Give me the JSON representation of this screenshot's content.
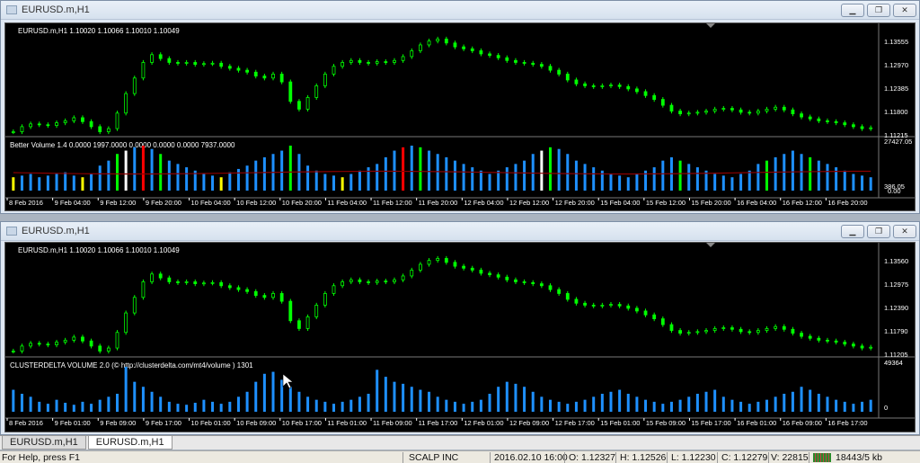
{
  "windows": [
    {
      "title": "EURUSD.m,H1",
      "price_header": "EURUSD.m,H1  1.10020 1.10066 1.10010 1.10049",
      "price_ticks": [
        "1.13555",
        "1.12970",
        "1.12385",
        "1.11800",
        "1.11215"
      ],
      "indicator_header": "Better Volume 1.4 0.0000 1997.0000 0.0000 0.0000 0.0000 7937.0000",
      "indicator_ticks": [
        "27427.05",
        "386.05"
      ],
      "indicator_zero_label": "0.00",
      "date_labels": [
        "8 Feb 2016",
        "9 Feb 04:00",
        "9 Feb 12:00",
        "9 Feb 20:00",
        "10 Feb 04:00",
        "10 Feb 12:00",
        "10 Feb 20:00",
        "11 Feb 04:00",
        "11 Feb 12:00",
        "11 Feb 20:00",
        "12 Feb 04:00",
        "12 Feb 12:00",
        "12 Feb 20:00",
        "15 Feb 04:00",
        "15 Feb 12:00",
        "15 Feb 20:00",
        "16 Feb 04:00",
        "16 Feb 12:00",
        "16 Feb 20:00"
      ]
    },
    {
      "title": "EURUSD.m,H1",
      "price_header": "EURUSD.m,H1  1.10020 1.10066 1.10010 1.10049",
      "price_ticks": [
        "1.13560",
        "1.12975",
        "1.12390",
        "1.11790",
        "1.11205"
      ],
      "indicator_header": "CLUSTERDELTA VOLUME 2.0 (© http://clusterdelta.com/mt4/volume ) 1301",
      "indicator_ticks": [
        "49364",
        "0"
      ],
      "date_labels": [
        "8 Feb 2016",
        "9 Feb 01:00",
        "9 Feb 09:00",
        "9 Feb 17:00",
        "10 Feb 01:00",
        "10 Feb 09:00",
        "10 Feb 17:00",
        "11 Feb 01:00",
        "11 Feb 09:00",
        "11 Feb 17:00",
        "12 Feb 01:00",
        "12 Feb 09:00",
        "12 Feb 17:00",
        "15 Feb 01:00",
        "15 Feb 09:00",
        "15 Feb 17:00",
        "16 Feb 01:00",
        "16 Feb 09:00",
        "16 Feb 17:00"
      ]
    }
  ],
  "tabs": [
    {
      "label": "EURUSD.m,H1",
      "active": false
    },
    {
      "label": "EURUSD.m,H1",
      "active": true
    }
  ],
  "status": {
    "help": "For Help, press F1",
    "profile": "SCALP INC",
    "datetime": "2016.02.10 16:00",
    "open": "O: 1.12327",
    "high": "H: 1.12526",
    "low": "L: 1.12230",
    "close": "C: 1.12279",
    "volume": "V: 22815",
    "traffic": "18443/5 kb"
  },
  "colors": {
    "candle": "#00ff00",
    "volume_bar": "#1e90ff",
    "climax_bar": "#ff0000",
    "churn_bar": "#00ff00",
    "low_bar": "#ffff00",
    "neutral_bar": "#ffffff",
    "avg_line": "#8b0000"
  },
  "price_series": [
    1.1122,
    1.1135,
    1.1142,
    1.114,
    1.1138,
    1.1145,
    1.115,
    1.1158,
    1.1148,
    1.1135,
    1.1122,
    1.113,
    1.117,
    1.122,
    1.126,
    1.13,
    1.132,
    1.131,
    1.13,
    1.1298,
    1.13,
    1.1295,
    1.1297,
    1.1298,
    1.129,
    1.1285,
    1.128,
    1.1275,
    1.1265,
    1.126,
    1.127,
    1.125,
    1.12,
    1.118,
    1.121,
    1.124,
    1.127,
    1.129,
    1.13,
    1.1305,
    1.13,
    1.1298,
    1.1302,
    1.13,
    1.1305,
    1.1315,
    1.133,
    1.1345,
    1.1355,
    1.136,
    1.135,
    1.134,
    1.1335,
    1.133,
    1.1322,
    1.1318,
    1.1312,
    1.1305,
    1.13,
    1.1298,
    1.1295,
    1.129,
    1.128,
    1.127,
    1.1255,
    1.1245,
    1.124,
    1.1238,
    1.124,
    1.1242,
    1.1238,
    1.1232,
    1.1225,
    1.1215,
    1.1205,
    1.119,
    1.1175,
    1.1168,
    1.117,
    1.1172,
    1.1175,
    1.118,
    1.1182,
    1.1178,
    1.1172,
    1.117,
    1.1175,
    1.118,
    1.1185,
    1.1178,
    1.1168,
    1.116,
    1.1155,
    1.115,
    1.1148,
    1.1145,
    1.114,
    1.1135,
    1.113,
    1.1132
  ],
  "bv_volume": [
    8,
    9,
    10,
    8,
    9,
    10,
    11,
    9,
    8,
    10,
    15,
    18,
    22,
    24,
    26,
    27,
    25,
    22,
    18,
    16,
    14,
    12,
    10,
    9,
    8,
    11,
    13,
    15,
    18,
    20,
    22,
    24,
    27,
    22,
    15,
    12,
    10,
    9,
    8,
    10,
    12,
    14,
    16,
    20,
    24,
    26,
    27,
    26,
    24,
    22,
    20,
    18,
    16,
    14,
    12,
    10,
    12,
    14,
    16,
    18,
    22,
    24,
    26,
    25,
    22,
    18,
    16,
    14,
    12,
    10,
    9,
    8,
    10,
    12,
    14,
    18,
    20,
    18,
    16,
    14,
    12,
    10,
    9,
    8,
    10,
    12,
    16,
    18,
    20,
    22,
    24,
    22,
    20,
    18,
    16,
    14,
    12,
    10,
    9,
    8
  ],
  "cd_volume": [
    22,
    18,
    15,
    10,
    8,
    12,
    9,
    7,
    10,
    8,
    12,
    15,
    18,
    45,
    30,
    25,
    20,
    15,
    10,
    8,
    7,
    9,
    12,
    10,
    8,
    10,
    15,
    20,
    30,
    38,
    40,
    32,
    25,
    20,
    15,
    12,
    10,
    8,
    10,
    12,
    15,
    18,
    42,
    35,
    30,
    28,
    25,
    22,
    20,
    15,
    12,
    10,
    8,
    10,
    12,
    18,
    25,
    30,
    28,
    25,
    20,
    15,
    12,
    10,
    8,
    10,
    12,
    15,
    18,
    20,
    22,
    18,
    15,
    12,
    10,
    8,
    10,
    12,
    15,
    18,
    20,
    22,
    15,
    12,
    10,
    8,
    10,
    12,
    15,
    18,
    20,
    25,
    22,
    18,
    15,
    12,
    10,
    8,
    10,
    12
  ]
}
